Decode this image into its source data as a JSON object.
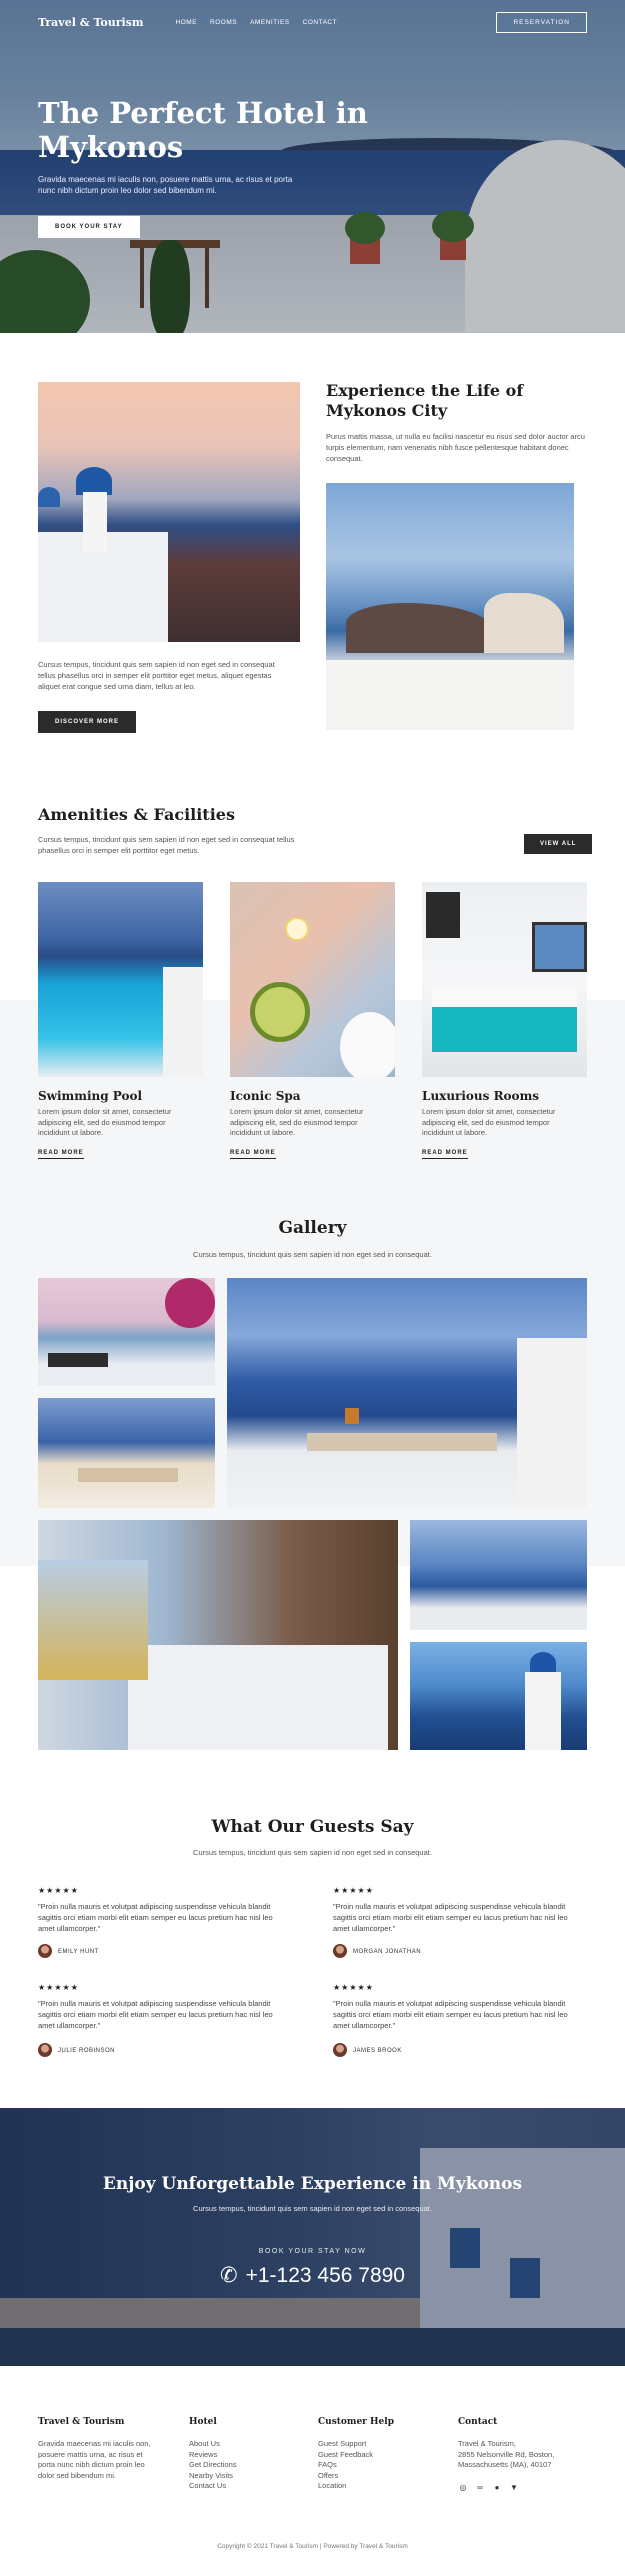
{
  "nav": {
    "logo": "Travel & Tourism",
    "items": [
      "HOME",
      "ROOMS",
      "AMENITIES",
      "CONTACT"
    ],
    "reservation": "RESERVATION"
  },
  "hero": {
    "title": "The Perfect Hotel in Mykonos",
    "text": "Gravida maecenas mi iaculis non, posuere mattis urna, ac risus et porta nunc nibh dictum proin leo dolor sed bibendum mi.",
    "button": "BOOK YOUR STAY"
  },
  "experience": {
    "title": "Experience the Life of Mykonos City",
    "text": "Purus mattis massa, ut nulla eu facilisi nascetur eu risus sed dolor auctor arcu turpis elementum, nam venenatis nibh fusce pellentesque habitant donec consequat.",
    "left_text": "Cursus tempus, tincidunt quis sem sapien id non eget sed in consequat tellus phasellus orci in semper elit porttitor eget metus, aliquet egestas aliquet erat congue sed urna diam, tellus at leo.",
    "button": "DISCOVER MORE"
  },
  "amenities": {
    "title": "Amenities & Facilities",
    "text": "Cursus tempus, tincidunt quis sem sapien id non eget sed in consequat tellus phasellus orci in semper elit porttitor eget metus.",
    "view_all": "VIEW ALL",
    "cards": [
      {
        "title": "Swimming Pool",
        "text": "Lorem ipsum dolor sit amet, consectetur adipiscing elit, sed do eiusmod tempor incididunt ut labore.",
        "link": "READ MORE"
      },
      {
        "title": "Iconic Spa",
        "text": "Lorem ipsum dolor sit amet, consectetur adipiscing elit, sed do eiusmod tempor incididunt ut labore.",
        "link": "READ MORE"
      },
      {
        "title": "Luxurious Rooms",
        "text": "Lorem ipsum dolor sit amet, consectetur adipiscing elit, sed do eiusmod tempor incididunt ut labore.",
        "link": "READ MORE"
      }
    ]
  },
  "gallery": {
    "title": "Gallery",
    "text": "Cursus tempus, tincidunt quis sem sapien id non eget sed in consequat."
  },
  "testimonials": {
    "title": "What Our Guests Say",
    "text": "Cursus tempus, tincidunt quis sem sapien id non eget sed in consequat.",
    "stars": "★★★★★",
    "items": [
      {
        "quote": "\"Proin nulla mauris et volutpat adipiscing suspendisse vehicula blandit sagittis orci etiam morbi elit etiam semper eu lacus pretium hac nisl leo amet ullamcorper.\"",
        "name": "EMILY HUNT"
      },
      {
        "quote": "\"Proin nulla mauris et volutpat adipiscing suspendisse vehicula blandit sagittis orci etiam morbi elit etiam semper eu lacus pretium hac nisl leo amet ullamcorper.\"",
        "name": "MORGAN JONATHAN"
      },
      {
        "quote": "\"Proin nulla mauris et volutpat adipiscing suspendisse vehicula blandit sagittis orci etiam morbi elit etiam semper eu lacus pretium hac nisl leo amet ullamcorper.\"",
        "name": "JULIE ROBINSON"
      },
      {
        "quote": "\"Proin nulla mauris et volutpat adipiscing suspendisse vehicula blandit sagittis orci etiam morbi elit etiam semper eu lacus pretium hac nisl leo amet ullamcorper.\"",
        "name": "JAMES BROOK"
      }
    ]
  },
  "cta": {
    "title": "Enjoy Unforgettable Experience in Mykonos",
    "text": "Cursus tempus, tincidunt quis sem sapien id non eget sed in consequat.",
    "label": "BOOK YOUR STAY NOW",
    "phone": "+1-123 456 7890"
  },
  "footer": {
    "col1": {
      "title": "Travel & Tourism",
      "text": "Gravida maecenas mi iaculis non, posuere mattis urna, ac risus et porta nunc nibh dictum proin leo dolor sed bibendum mi."
    },
    "col2": {
      "title": "Hotel",
      "links": [
        "About Us",
        "Reviews",
        "Get Directions",
        "Nearby Visits",
        "Contact Us"
      ]
    },
    "col3": {
      "title": "Customer Help",
      "links": [
        "Guest Support",
        "Guest Feedback",
        "FAQs",
        "Offers",
        "Location"
      ]
    },
    "col4": {
      "title": "Contact",
      "lines": [
        "Travel & Tourism,",
        "2855 Nelsonville Rd, Boston,",
        "Massachusetts (MA), 40107"
      ]
    },
    "social": [
      "instagram-icon",
      "tripadvisor-icon",
      "facebook-icon",
      "twitter-icon"
    ],
    "copyright": "Copyright © 2021 Travel & Tourism | Powered by Travel & Tourism"
  }
}
